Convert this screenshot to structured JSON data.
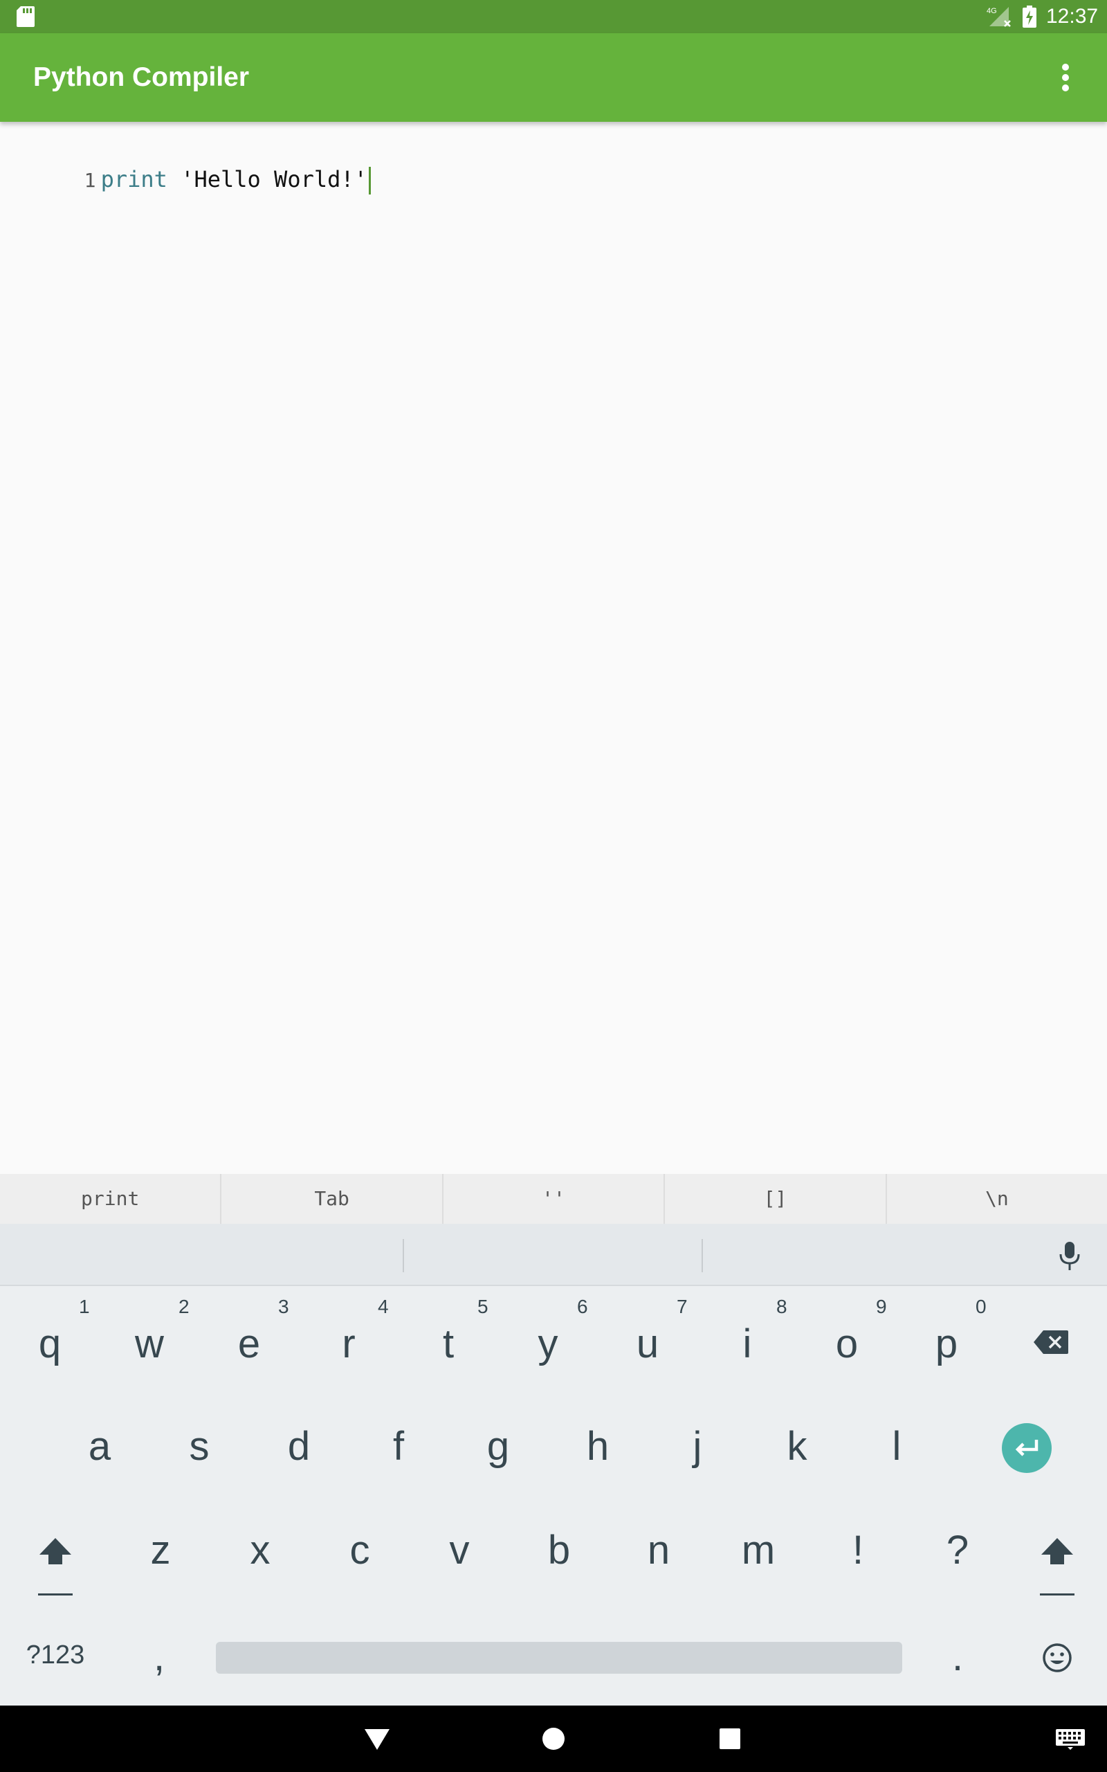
{
  "status_bar": {
    "time": "12:37",
    "network": "4G",
    "icons": [
      "sd-card-icon",
      "signal-icon",
      "battery-charging-icon"
    ]
  },
  "app_bar": {
    "title": "Python Compiler",
    "menu_icon": "overflow-menu-icon"
  },
  "editor": {
    "lines": [
      {
        "number": "1",
        "keyword": "print",
        "rest": " 'Hello World!'"
      }
    ]
  },
  "shortcuts": [
    "print",
    "Tab",
    "''",
    "[]",
    "\\n"
  ],
  "keyboard": {
    "row1": [
      {
        "key": "q",
        "hint": "1"
      },
      {
        "key": "w",
        "hint": "2"
      },
      {
        "key": "e",
        "hint": "3"
      },
      {
        "key": "r",
        "hint": "4"
      },
      {
        "key": "t",
        "hint": "5"
      },
      {
        "key": "y",
        "hint": "6"
      },
      {
        "key": "u",
        "hint": "7"
      },
      {
        "key": "i",
        "hint": "8"
      },
      {
        "key": "o",
        "hint": "9"
      },
      {
        "key": "p",
        "hint": "0"
      }
    ],
    "row2": [
      "a",
      "s",
      "d",
      "f",
      "g",
      "h",
      "j",
      "k",
      "l"
    ],
    "row3": [
      "z",
      "x",
      "c",
      "v",
      "b",
      "n",
      "m",
      "!",
      "?"
    ],
    "symbols_key": "?123",
    "comma_key": ",",
    "period_key": ".",
    "icons": [
      "microphone-icon",
      "backspace-icon",
      "enter-icon",
      "shift-icon",
      "emoji-icon"
    ]
  },
  "nav_bar": {
    "icons": [
      "back-icon",
      "home-icon",
      "recents-icon",
      "keyboard-switch-icon"
    ]
  },
  "colors": {
    "status_bar": "#579834",
    "app_bar": "#65b33c",
    "enter_key": "#4db6ac",
    "keyboard_bg": "#eceff1"
  }
}
